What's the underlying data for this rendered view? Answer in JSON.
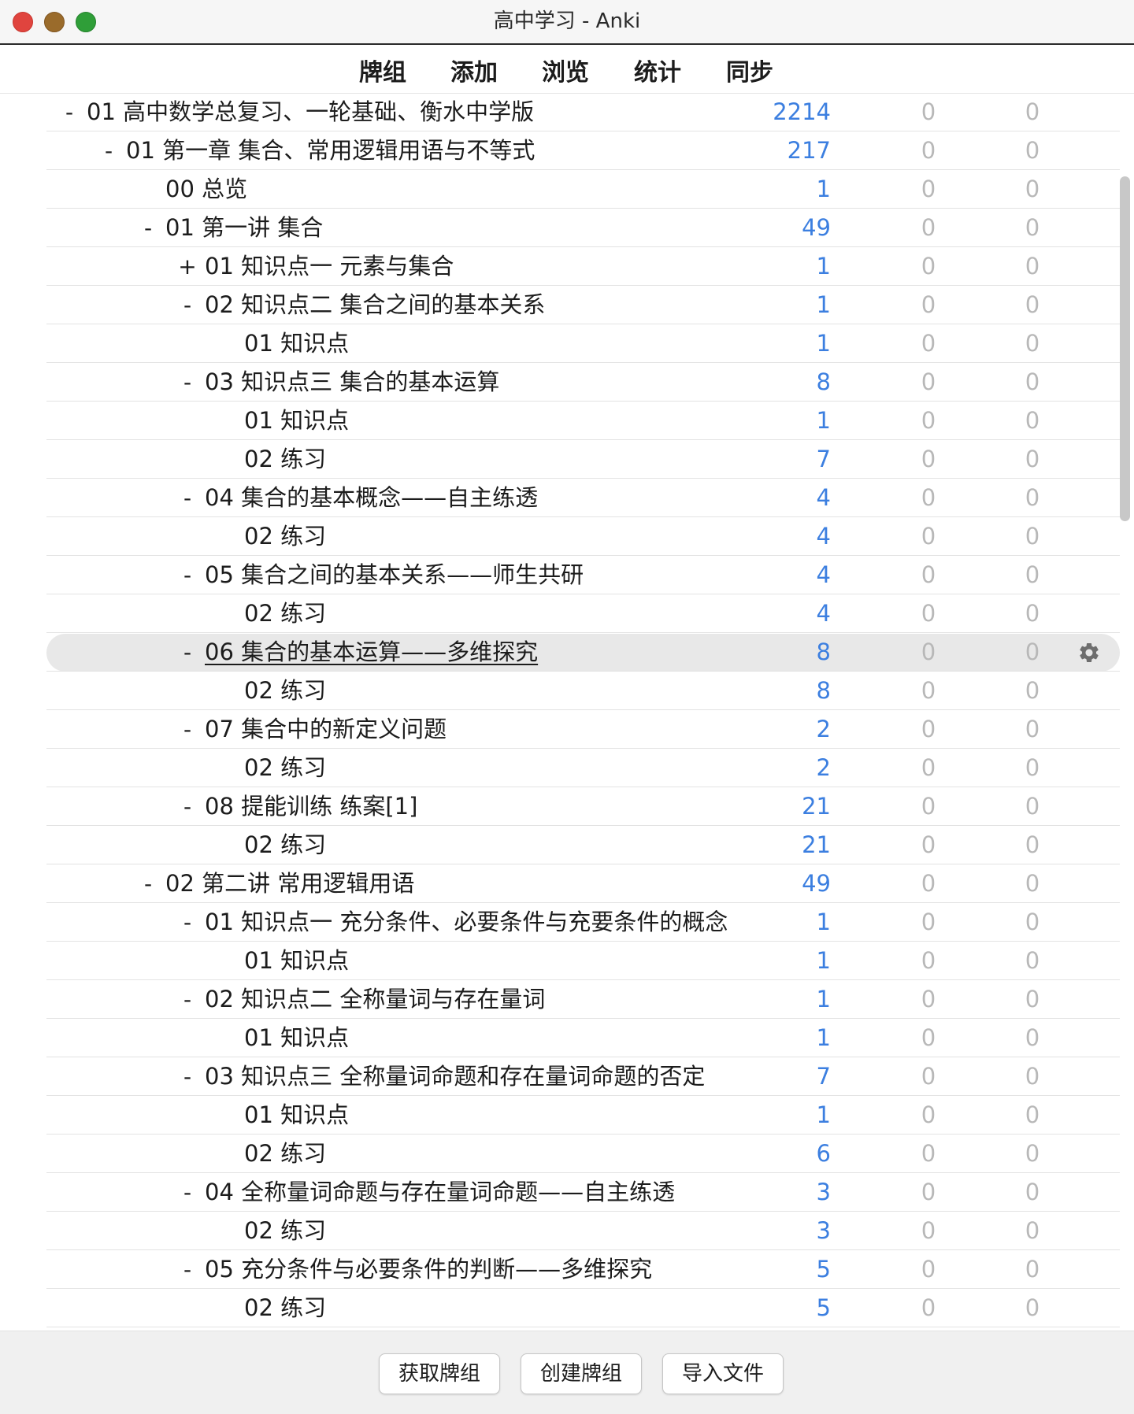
{
  "window": {
    "title": "高中学习 - Anki"
  },
  "toolbar": {
    "decks": "牌组",
    "add": "添加",
    "browse": "浏览",
    "stats": "统计",
    "sync": "同步"
  },
  "decks": [
    {
      "toggle": "-",
      "name": "01 高中数学总复习、一轮基础、衡水中学版",
      "due": "2214",
      "learn": "0",
      "new": "0",
      "level": 0
    },
    {
      "toggle": "-",
      "name": "01 第一章 集合、常用逻辑用语与不等式",
      "due": "217",
      "learn": "0",
      "new": "0",
      "level": 1
    },
    {
      "toggle": "",
      "name": "00 总览",
      "due": "1",
      "learn": "0",
      "new": "0",
      "level": 2
    },
    {
      "toggle": "-",
      "name": "01 第一讲 集合",
      "due": "49",
      "learn": "0",
      "new": "0",
      "level": 2
    },
    {
      "toggle": "+",
      "name": "01 知识点一 元素与集合",
      "due": "1",
      "learn": "0",
      "new": "0",
      "level": 3
    },
    {
      "toggle": "-",
      "name": "02 知识点二 集合之间的基本关系",
      "due": "1",
      "learn": "0",
      "new": "0",
      "level": 3
    },
    {
      "toggle": "",
      "name": "01 知识点",
      "due": "1",
      "learn": "0",
      "new": "0",
      "level": 4
    },
    {
      "toggle": "-",
      "name": "03 知识点三 集合的基本运算",
      "due": "8",
      "learn": "0",
      "new": "0",
      "level": 3
    },
    {
      "toggle": "",
      "name": "01 知识点",
      "due": "1",
      "learn": "0",
      "new": "0",
      "level": 4
    },
    {
      "toggle": "",
      "name": "02 练习",
      "due": "7",
      "learn": "0",
      "new": "0",
      "level": 4
    },
    {
      "toggle": "-",
      "name": "04 集合的基本概念——自主练透",
      "due": "4",
      "learn": "0",
      "new": "0",
      "level": 3
    },
    {
      "toggle": "",
      "name": "02 练习",
      "due": "4",
      "learn": "0",
      "new": "0",
      "level": 4
    },
    {
      "toggle": "-",
      "name": "05 集合之间的基本关系——师生共研",
      "due": "4",
      "learn": "0",
      "new": "0",
      "level": 3
    },
    {
      "toggle": "",
      "name": "02 练习",
      "due": "4",
      "learn": "0",
      "new": "0",
      "level": 4
    },
    {
      "toggle": "-",
      "name": "06 集合的基本运算——多维探究",
      "due": "8",
      "learn": "0",
      "new": "0",
      "level": 3,
      "current": true
    },
    {
      "toggle": "",
      "name": "02 练习",
      "due": "8",
      "learn": "0",
      "new": "0",
      "level": 4
    },
    {
      "toggle": "-",
      "name": "07 集合中的新定义问题",
      "due": "2",
      "learn": "0",
      "new": "0",
      "level": 3
    },
    {
      "toggle": "",
      "name": "02 练习",
      "due": "2",
      "learn": "0",
      "new": "0",
      "level": 4
    },
    {
      "toggle": "-",
      "name": "08 提能训练 练案[1]",
      "due": "21",
      "learn": "0",
      "new": "0",
      "level": 3
    },
    {
      "toggle": "",
      "name": "02 练习",
      "due": "21",
      "learn": "0",
      "new": "0",
      "level": 4
    },
    {
      "toggle": "-",
      "name": "02 第二讲 常用逻辑用语",
      "due": "49",
      "learn": "0",
      "new": "0",
      "level": 2
    },
    {
      "toggle": "-",
      "name": "01 知识点一 充分条件、必要条件与充要条件的概念",
      "due": "1",
      "learn": "0",
      "new": "0",
      "level": 3
    },
    {
      "toggle": "",
      "name": "01 知识点",
      "due": "1",
      "learn": "0",
      "new": "0",
      "level": 4
    },
    {
      "toggle": "-",
      "name": "02 知识点二 全称量词与存在量词",
      "due": "1",
      "learn": "0",
      "new": "0",
      "level": 3
    },
    {
      "toggle": "",
      "name": "01 知识点",
      "due": "1",
      "learn": "0",
      "new": "0",
      "level": 4
    },
    {
      "toggle": "-",
      "name": "03 知识点三 全称量词命题和存在量词命题的否定",
      "due": "7",
      "learn": "0",
      "new": "0",
      "level": 3
    },
    {
      "toggle": "",
      "name": "01 知识点",
      "due": "1",
      "learn": "0",
      "new": "0",
      "level": 4
    },
    {
      "toggle": "",
      "name": "02 练习",
      "due": "6",
      "learn": "0",
      "new": "0",
      "level": 4
    },
    {
      "toggle": "-",
      "name": "04 全称量词命题与存在量词命题——自主练透",
      "due": "3",
      "learn": "0",
      "new": "0",
      "level": 3
    },
    {
      "toggle": "",
      "name": "02 练习",
      "due": "3",
      "learn": "0",
      "new": "0",
      "level": 4
    },
    {
      "toggle": "-",
      "name": "05 充分条件与必要条件的判断——多维探究",
      "due": "5",
      "learn": "0",
      "new": "0",
      "level": 3
    },
    {
      "toggle": "",
      "name": "02 练习",
      "due": "5",
      "learn": "0",
      "new": "0",
      "level": 4
    }
  ],
  "bottom": {
    "get_shared": "获取牌组",
    "create_deck": "创建牌组",
    "import_file": "导入文件"
  },
  "colors": {
    "due": "#3c7fe0",
    "zero": "#b8b8b8",
    "highlight": "#e8e8e8"
  },
  "icons": {
    "options": "gear-icon"
  }
}
